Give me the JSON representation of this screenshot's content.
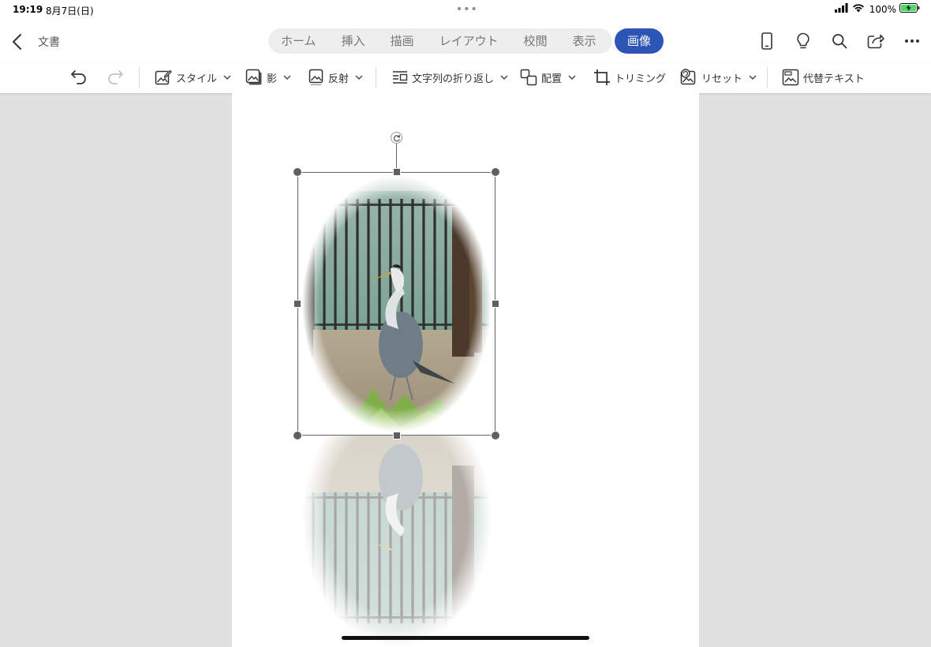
{
  "status_bar": {
    "time": "19:19",
    "date": "8月7日(日)",
    "dots": "•••",
    "battery": "100%"
  },
  "header": {
    "back_icon": "chevron-left-icon",
    "doc_title": "文書",
    "tabs": [
      "ホーム",
      "挿入",
      "描画",
      "レイアウト",
      "校閲",
      "表示"
    ],
    "active_tab": "画像",
    "icons": [
      "phone-icon",
      "lightbulb-icon",
      "search-icon",
      "share-icon",
      "more-icon"
    ]
  },
  "ribbon": {
    "undo_icon": "undo-icon",
    "redo_icon": "redo-icon",
    "style": "スタイル",
    "shadow": "影",
    "reflection": "反射",
    "wrap_text": "文字列の折り返し",
    "arrange": "配置",
    "crop": "トリミング",
    "reset": "リセット",
    "alt_text": "代替テキスト"
  },
  "colors": {
    "accent": "#2d55b6",
    "page_bg": "#e1e1e1"
  },
  "document": {
    "image": "heron-photo-oval",
    "reflection": "heron-photo-reflection"
  }
}
